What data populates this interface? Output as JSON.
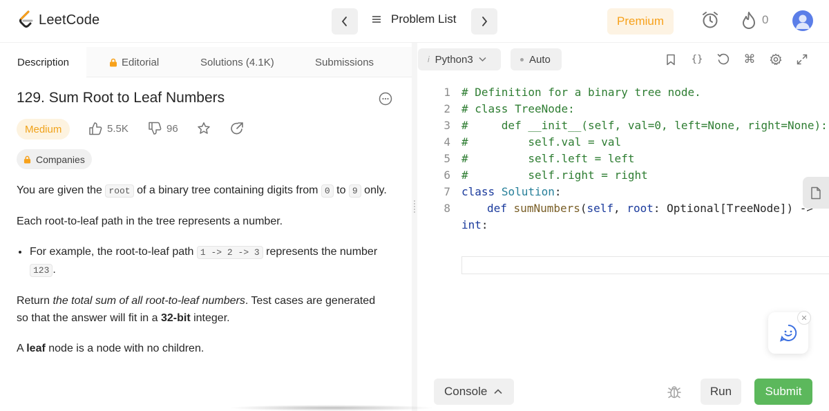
{
  "header": {
    "logo_text": "LeetCode",
    "problem_list_label": "Problem List",
    "premium_label": "Premium",
    "streak_count": "0"
  },
  "left_tabs": [
    {
      "label": "Description"
    },
    {
      "label": "Editorial"
    },
    {
      "label": "Solutions (4.1K)"
    },
    {
      "label": "Submissions"
    }
  ],
  "problem": {
    "title": "129. Sum Root to Leaf Numbers",
    "difficulty": "Medium",
    "likes": "5.5K",
    "dislikes": "96",
    "companies_label": "Companies",
    "p1_a": "You are given the ",
    "p1_code1": "root",
    "p1_b": " of a binary tree containing digits from ",
    "p1_code2": "0",
    "p1_c": " to ",
    "p1_code3": "9",
    "p1_d": " only.",
    "p2": "Each root-to-leaf path in the tree represents a number.",
    "li_a": "For example, the root-to-leaf path ",
    "li_code1": "1 -> 2 -> 3",
    "li_b": " represents the number ",
    "li_code2": "123",
    "li_c": ".",
    "p3_a": "Return ",
    "p3_em": "the total sum of all root-to-leaf numbers",
    "p3_b": ". Test cases are generated so that the answer will fit in a ",
    "p3_strong": "32-bit",
    "p3_c": " integer.",
    "p4_a": "A ",
    "p4_strong": "leaf",
    "p4_b": " node is a node with no children."
  },
  "editor": {
    "language": "Python3",
    "mode": "Auto",
    "line_numbers": [
      "1",
      "2",
      "3",
      "4",
      "5",
      "6",
      "7",
      "8"
    ],
    "code": {
      "l1": "# Definition for a binary tree node.",
      "l2": "# class TreeNode:",
      "l3": "#     def __init__(self, val=0, left=None, right=None):",
      "l4": "#         self.val = val",
      "l5": "#         self.left = left",
      "l6": "#         self.right = right",
      "l7_kw": "class",
      "l7_name": "Solution",
      "l7_end": ":",
      "l8_kw": "def",
      "l8_fn": "sumNumbers",
      "l8_open": "(",
      "l8_self": "self",
      "l8_mid": ", ",
      "l8_root": "root",
      "l8_rest": ": Optional[TreeNode]) ->",
      "l9_kw": "int",
      "l9_end": ":"
    }
  },
  "bottom": {
    "console_label": "Console",
    "run_label": "Run",
    "submit_label": "Submit"
  },
  "colors": {
    "premium": "#f7a11a",
    "medium": "#f0a21a",
    "submit": "#5cb85c",
    "comment": "#2e7d32",
    "keyword": "#1a3a9c"
  }
}
